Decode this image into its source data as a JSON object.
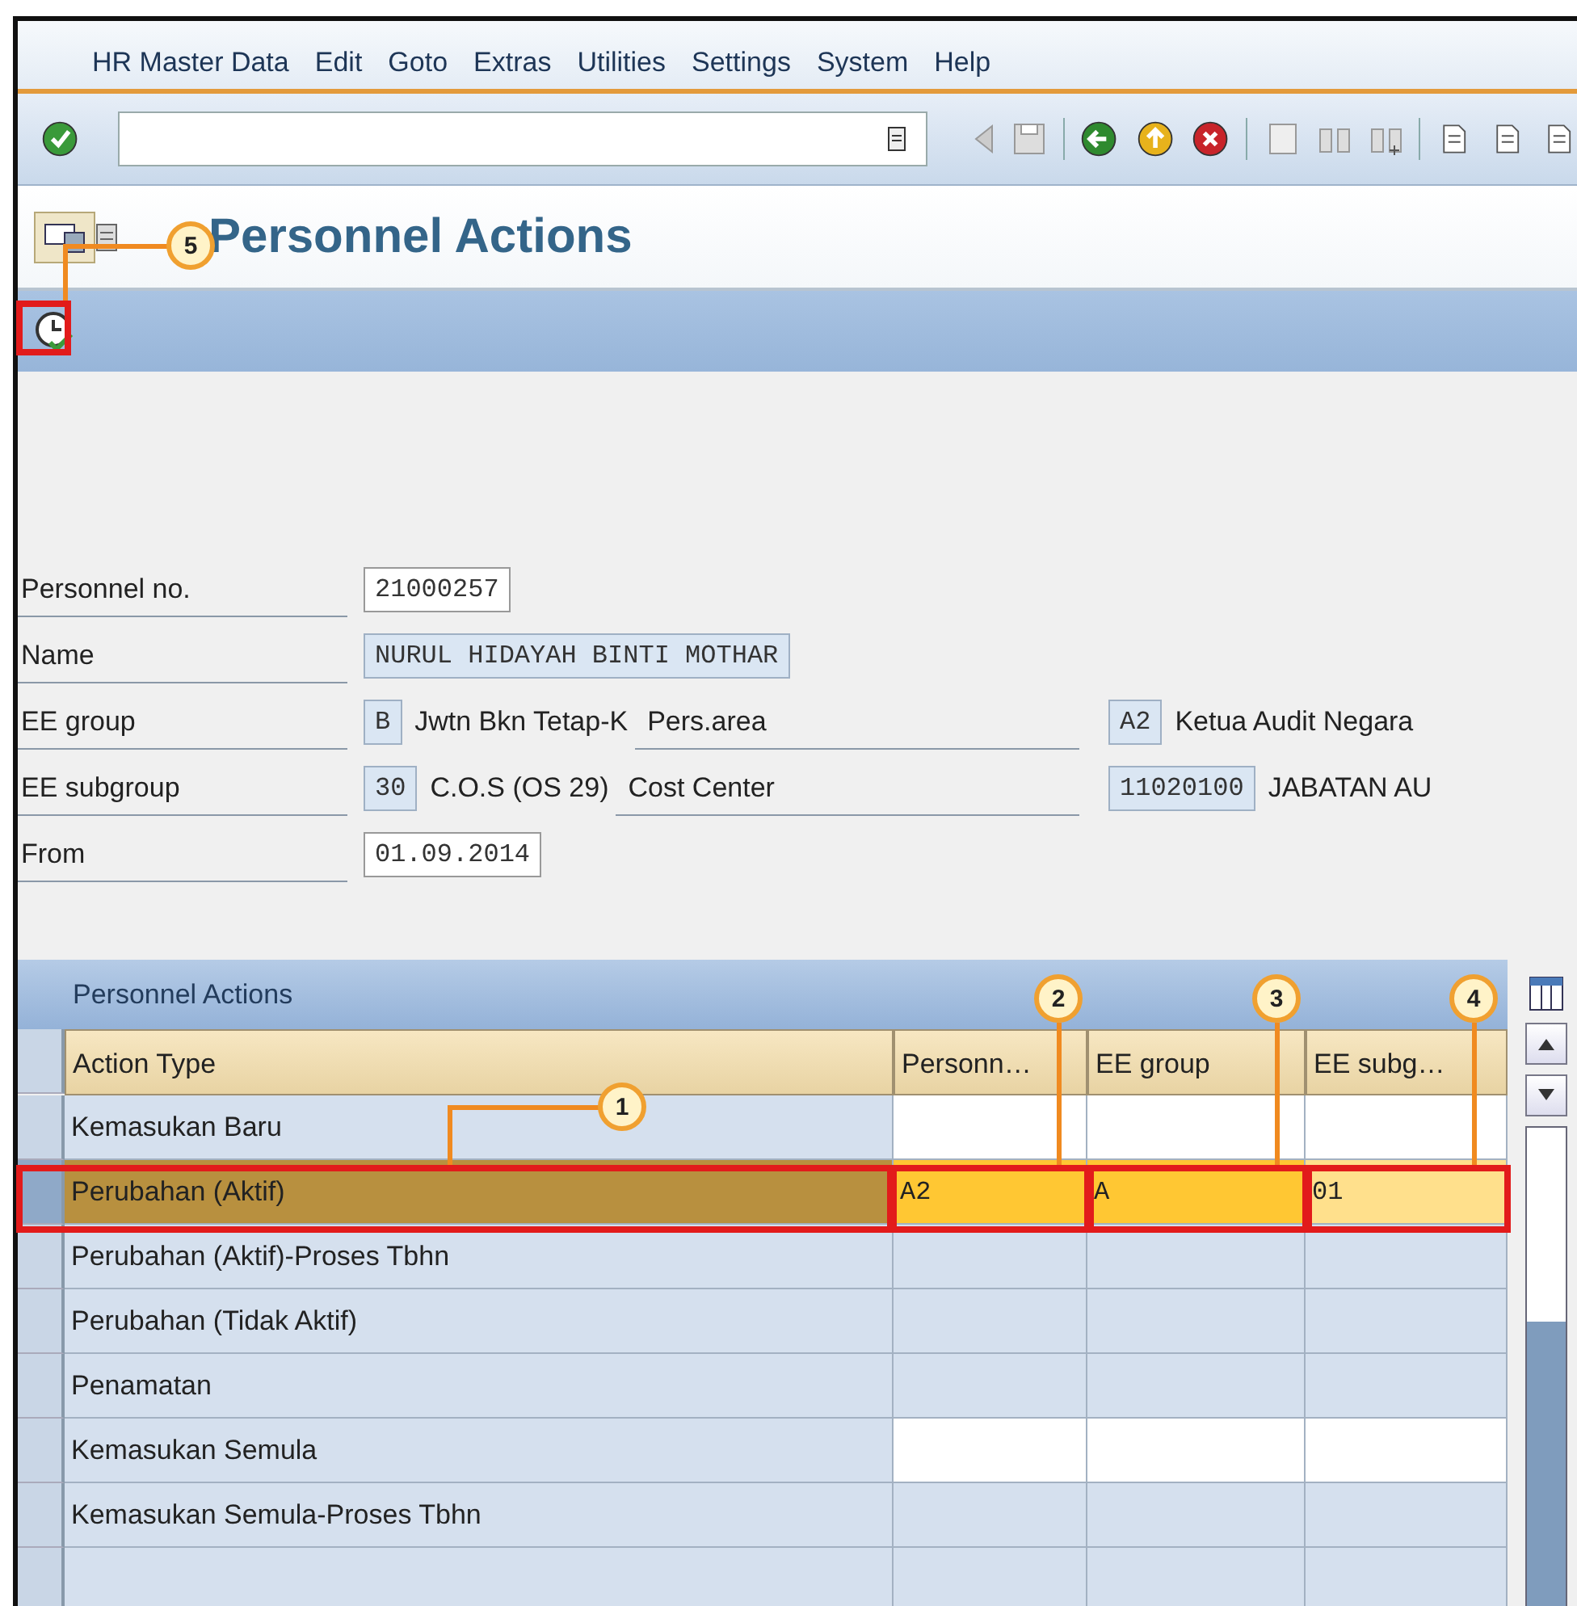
{
  "menu": [
    "HR Master Data",
    "Edit",
    "Goto",
    "Extras",
    "Utilities",
    "Settings",
    "System",
    "Help"
  ],
  "title": "Personnel Actions",
  "form_rows": [
    {
      "label": "Personnel no.",
      "field": {
        "value": "21000257",
        "editable": true
      }
    },
    {
      "label": "Name",
      "field": {
        "value": "NURUL HIDAYAH BINTI MOTHAR",
        "editable": false
      }
    },
    {
      "label": "EE group",
      "field": {
        "value": "B",
        "editable": false
      },
      "description": "Jwtn Bkn Tetap-K",
      "right": {
        "label": "Pers.area",
        "field": {
          "value": "A2",
          "editable": false
        },
        "description": "Ketua Audit Negara"
      }
    },
    {
      "label": "EE subgroup",
      "field": {
        "value": "30",
        "editable": false
      },
      "description": "C.O.S (OS 29)",
      "right": {
        "label": "Cost Center",
        "field": {
          "value": "11020100",
          "editable": false
        },
        "description": "JABATAN AU"
      }
    },
    {
      "label": "From",
      "field": {
        "value": "01.09.2014",
        "editable": true
      }
    }
  ],
  "table": {
    "title": "Personnel Actions",
    "columns": [
      "Action Type",
      "Personn…",
      "EE group",
      "EE subg…"
    ],
    "rows": [
      {
        "action": "Kemasukan Baru",
        "selected": false,
        "editable": true
      },
      {
        "action": "Perubahan (Aktif)",
        "selected": true,
        "editable": true,
        "values": [
          "A2",
          "A",
          "01"
        ]
      },
      {
        "action": "Perubahan (Aktif)-Proses Tbhn",
        "selected": false,
        "editable": false
      },
      {
        "action": "Perubahan (Tidak Aktif)",
        "selected": false,
        "editable": false
      },
      {
        "action": "Penamatan",
        "selected": false,
        "editable": false
      },
      {
        "action": "Kemasukan Semula",
        "selected": false,
        "editable": true
      },
      {
        "action": "Kemasukan Semula-Proses Tbhn",
        "selected": false,
        "editable": false
      }
    ]
  },
  "callouts": [
    "1",
    "2",
    "3",
    "4",
    "5"
  ]
}
